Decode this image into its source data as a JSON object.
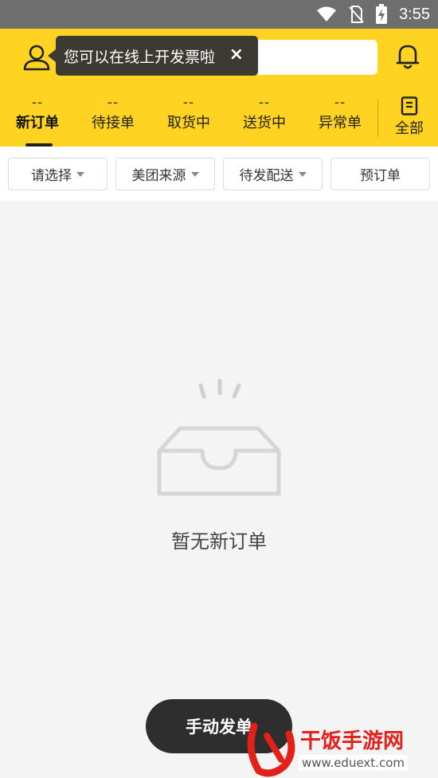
{
  "status_bar": {
    "time": "3:55"
  },
  "header": {
    "tooltip_text": "您可以在线上开发票啦",
    "tooltip_close": "×",
    "tabs": [
      {
        "count": "--",
        "label": "新订单",
        "active": true
      },
      {
        "count": "--",
        "label": "待接单"
      },
      {
        "count": "--",
        "label": "取货中"
      },
      {
        "count": "--",
        "label": "送货中"
      },
      {
        "count": "--",
        "label": "异常单"
      }
    ],
    "all_tab_label": "全部"
  },
  "filters": {
    "select": "请选择",
    "source": "美团来源",
    "dispatch": "待发配送",
    "preorder": "预订单"
  },
  "empty_state": {
    "text": "暂无新订单"
  },
  "manual_button": {
    "label": "手动发单"
  },
  "watermark": {
    "text": "干饭手游网",
    "url": "www.eduext.com"
  },
  "colors": {
    "header_yellow": "#ffd321",
    "status_bar": "#6e6e6e",
    "button_dark": "#2e2e2e",
    "watermark_red": "#e3211a"
  },
  "icons": [
    "wifi-icon",
    "no-sim-icon",
    "battery-charging-icon",
    "user-icon",
    "bell-icon",
    "document-icon",
    "empty-inbox-icon",
    "close-icon",
    "caret-down-icon"
  ]
}
